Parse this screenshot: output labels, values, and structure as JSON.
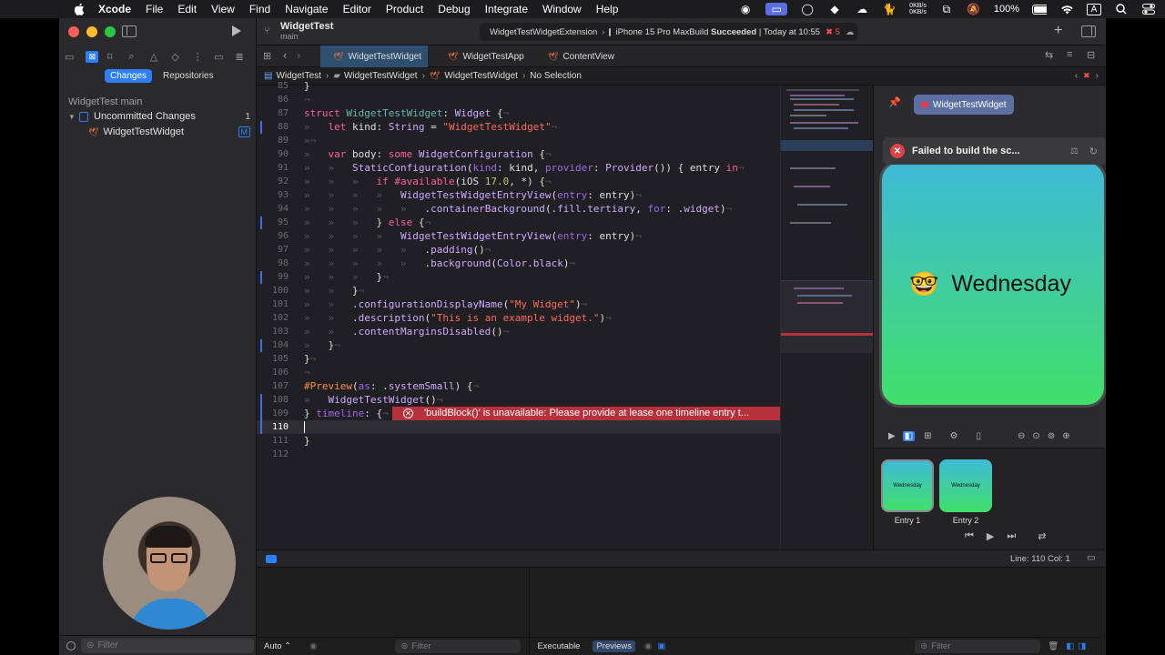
{
  "menubar": {
    "app": "Xcode",
    "items": [
      "File",
      "Edit",
      "View",
      "Find",
      "Navigate",
      "Editor",
      "Product",
      "Debug",
      "Integrate",
      "Window",
      "Help"
    ],
    "net_up": "0KB/s",
    "net_down": "0KB/s",
    "battery": "100%",
    "input": "A",
    "datetime": ""
  },
  "sidebar": {
    "tabs": [
      "Changes",
      "Repositories"
    ],
    "project": "WidgetTest",
    "branch": "main",
    "group": "Uncommitted Changes",
    "group_count": "1",
    "file": "WidgetTestWidget",
    "file_badge": "M",
    "filter_placeholder": "Filter"
  },
  "toolbar": {
    "project": "WidgetTest",
    "branch": "main",
    "scheme": "WidgetTestWidgetExtension",
    "device": "iPhone 15 Pro Max",
    "status_prefix": "Build",
    "status_bold": "Succeeded",
    "status_time": "Today at 10:55",
    "errors": "5"
  },
  "tabs": [
    "WidgetTestWidget",
    "WidgetTestApp",
    "ContentView"
  ],
  "jumpbar": [
    "WidgetTest",
    "WidgetTestWidget",
    "WidgetTestWidget",
    "No Selection"
  ],
  "editor": {
    "error_message": "'buildBlock()' is unavailable: Please provide at lease one timeline entry t...",
    "current_line": "110"
  },
  "preview": {
    "pinned": "WidgetTestWidget",
    "failure": "Failed to build the sc...",
    "weekday": "Wednesday",
    "emoji": "🤓",
    "entries": [
      "Entry 1",
      "Entry 2"
    ],
    "entry_text": "Wednesday"
  },
  "debug": {
    "position": "Line: 110  Col: 1",
    "auto": "Auto ⌃",
    "filter": "Filter",
    "executable": "Executable",
    "previews": "Previews",
    "filter2": "Filter"
  },
  "colors": {
    "accent": "#2d7ff9",
    "error": "#b7313c",
    "widget_top": "#3fbad6",
    "widget_bottom": "#40e06a"
  }
}
